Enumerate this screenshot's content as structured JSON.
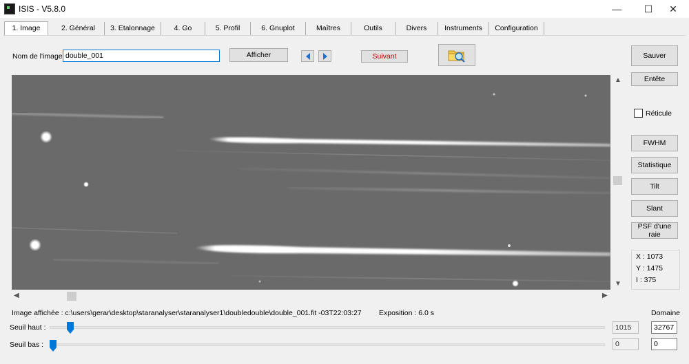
{
  "window": {
    "title": "ISIS - V5.8.0",
    "controls": [
      "—",
      "☐",
      "✕"
    ]
  },
  "tabs": [
    {
      "label": "1. Image",
      "active": true
    },
    {
      "label": "2. Général"
    },
    {
      "label": "3. Etalonnage"
    },
    {
      "label": "4. Go"
    },
    {
      "label": "5. Profil"
    },
    {
      "label": "6. Gnuplot"
    },
    {
      "label": "Maîtres"
    },
    {
      "label": "Outils"
    },
    {
      "label": "Divers"
    },
    {
      "label": "Instruments"
    },
    {
      "label": "Configuration"
    }
  ],
  "image_name": {
    "label": "Nom de l'image :",
    "value": "double_001"
  },
  "buttons": {
    "afficher": "Afficher",
    "suivant": "Suivant",
    "sauver": "Sauver",
    "entete": "Entête",
    "fwhm": "FWHM",
    "statistique": "Statistique",
    "tilt": "Tilt",
    "slant": "Slant",
    "psf": "PSF d'une raie"
  },
  "reticule": {
    "label": "Réticule",
    "checked": false
  },
  "coords": {
    "x": "X : 1073",
    "y": "Y : 1475",
    "i": "I  : 375"
  },
  "status": {
    "image_path": "Image affichée : c:\\users\\gerar\\desktop\\staranalyser\\staranalyser1\\doubledouble\\double_001.fit  -03T22:03:27",
    "exposure": "Exposition : 6.0 s"
  },
  "thresholds": {
    "domain_label": "Domaine",
    "high_label": "Seuil haut :",
    "high_value": "1015",
    "high_domain": "32767",
    "high_slider_fraction": 0.031,
    "low_label": "Seuil bas :",
    "low_value": "0",
    "low_domain": "0",
    "low_slider_fraction": 0.0
  },
  "colors": {
    "accent": "#0078d7",
    "suivant_text": "#c00000",
    "image_background": "#6a6a6a"
  }
}
